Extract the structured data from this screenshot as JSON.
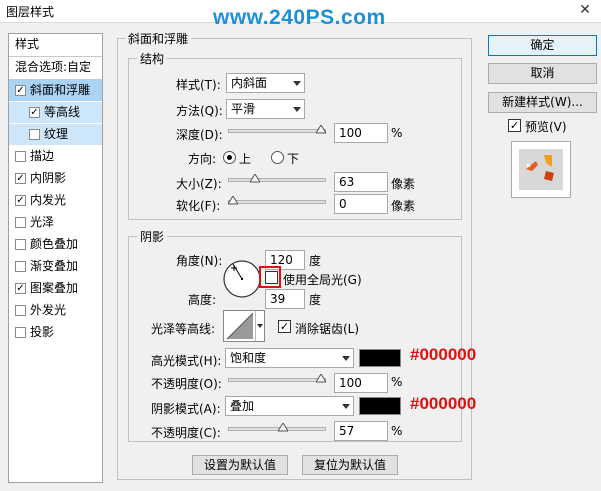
{
  "window": {
    "title": "图层样式",
    "watermark": "www.240PS.com",
    "close": "✕"
  },
  "styles_list": {
    "header": "样式",
    "blend_options": "混合选项:自定",
    "items": [
      {
        "label": "斜面和浮雕",
        "checked": true
      },
      {
        "label": "等高线",
        "checked": true
      },
      {
        "label": "纹理",
        "checked": false
      },
      {
        "label": "描边",
        "checked": false
      },
      {
        "label": "内阴影",
        "checked": true
      },
      {
        "label": "内发光",
        "checked": true
      },
      {
        "label": "光泽",
        "checked": false
      },
      {
        "label": "颜色叠加",
        "checked": false
      },
      {
        "label": "渐变叠加",
        "checked": false
      },
      {
        "label": "图案叠加",
        "checked": true
      },
      {
        "label": "外发光",
        "checked": false
      },
      {
        "label": "投影",
        "checked": false
      }
    ]
  },
  "bevel": {
    "section_title": "斜面和浮雕",
    "structure": {
      "title": "结构",
      "style_label": "样式(T):",
      "style_value": "内斜面",
      "technique_label": "方法(Q):",
      "technique_value": "平滑",
      "depth_label": "深度(D):",
      "depth_value": "100",
      "depth_unit": "%",
      "depth_pct": 100,
      "direction_label": "方向:",
      "dir_up": "上",
      "dir_down": "下",
      "size_label": "大小(Z):",
      "size_value": "63",
      "size_unit": "像素",
      "size_pct": 25,
      "soften_label": "软化(F):",
      "soften_value": "0",
      "soften_unit": "像素",
      "soften_pct": 0
    },
    "shading": {
      "title": "阴影",
      "angle_label": "角度(N):",
      "angle_value": "120",
      "angle_unit": "度",
      "global_light_label": "使用全局光(G)",
      "global_light_checked": false,
      "altitude_label": "高度:",
      "altitude_value": "39",
      "altitude_unit": "度",
      "gloss_label": "光泽等高线:",
      "antialias_label": "消除锯齿(L)",
      "antialias_checked": true,
      "highlight_label": "高光模式(H):",
      "highlight_value": "饱和度",
      "highlight_color": "#000000",
      "highlight_hex": "#000000",
      "h_opacity_label": "不透明度(O):",
      "h_opacity_value": "100",
      "h_opacity_unit": "%",
      "h_opacity_pct": 100,
      "shadow_label": "阴影模式(A):",
      "shadow_value": "叠加",
      "shadow_color": "#000000",
      "shadow_hex": "#000000",
      "s_opacity_label": "不透明度(C):",
      "s_opacity_value": "57",
      "s_opacity_unit": "%",
      "s_opacity_pct": 57
    },
    "make_default": "设置为默认值",
    "reset_default": "复位为默认值"
  },
  "right": {
    "ok": "确定",
    "cancel": "取消",
    "new_style": "新建样式(W)...",
    "preview_label": "预览(V)",
    "preview_checked": true
  },
  "colors": {
    "selected_bg": "#aad4f5",
    "hex_text": "#e01010",
    "watermark": "#1f8fd6"
  }
}
